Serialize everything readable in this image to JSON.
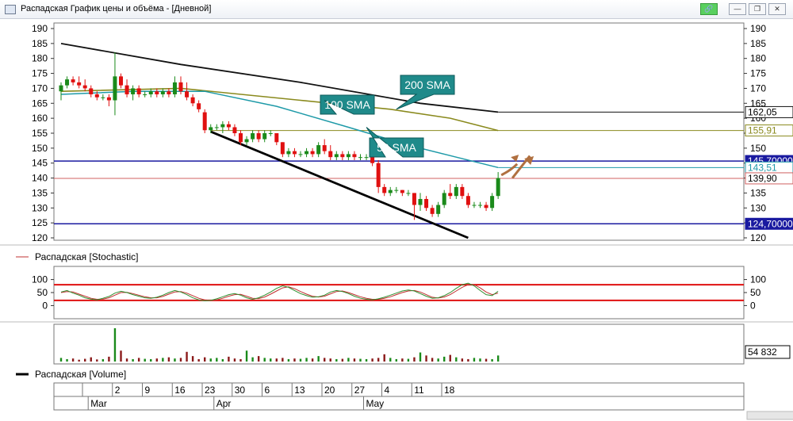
{
  "window": {
    "title": "Распадская График цены и объёма - [Дневной]",
    "buttons": {
      "link": "🔗",
      "min": "—",
      "max": "❐",
      "close": "✕"
    }
  },
  "colors": {
    "up": "#1a8a1a",
    "down": "#e01010",
    "sma50": "#1e9aa8",
    "sma100": "#8a8a1e",
    "sma200": "#111111",
    "hline_blue": "#1a1aa0",
    "hline_red": "#d06060",
    "callout_bg": "#1f8a8a",
    "arrow": "#b07040",
    "stoch_k": "#2f8f2f",
    "stoch_d": "#c03030",
    "stoch_level": "#e01010"
  },
  "chart_data": [
    {
      "type": "candlestick",
      "title": "",
      "ylim": [
        120,
        190
      ],
      "y_ticks": [
        120,
        125,
        130,
        135,
        140,
        145,
        150,
        155,
        160,
        165,
        170,
        175,
        180,
        185,
        190
      ],
      "candles": [
        {
          "o": 169,
          "h": 172,
          "l": 166,
          "c": 171
        },
        {
          "o": 171,
          "h": 174,
          "l": 170,
          "c": 173
        },
        {
          "o": 173,
          "h": 174,
          "l": 171,
          "c": 172
        },
        {
          "o": 172,
          "h": 174,
          "l": 170,
          "c": 171
        },
        {
          "o": 171,
          "h": 173,
          "l": 169,
          "c": 170
        },
        {
          "o": 170,
          "h": 171,
          "l": 167,
          "c": 168
        },
        {
          "o": 168,
          "h": 169,
          "l": 166,
          "c": 167
        },
        {
          "o": 167,
          "h": 168,
          "l": 166,
          "c": 167
        },
        {
          "o": 167,
          "h": 168,
          "l": 164,
          "c": 166
        },
        {
          "o": 166,
          "h": 182,
          "l": 161,
          "c": 174
        },
        {
          "o": 174,
          "h": 175,
          "l": 170,
          "c": 171
        },
        {
          "o": 171,
          "h": 173,
          "l": 167,
          "c": 168
        },
        {
          "o": 168,
          "h": 171,
          "l": 166,
          "c": 170
        },
        {
          "o": 170,
          "h": 171,
          "l": 167,
          "c": 168
        },
        {
          "o": 168,
          "h": 169,
          "l": 167,
          "c": 168
        },
        {
          "o": 168,
          "h": 170,
          "l": 167,
          "c": 169
        },
        {
          "o": 169,
          "h": 170,
          "l": 167,
          "c": 168
        },
        {
          "o": 168,
          "h": 170,
          "l": 167,
          "c": 169
        },
        {
          "o": 169,
          "h": 170,
          "l": 167,
          "c": 168
        },
        {
          "o": 168,
          "h": 174,
          "l": 167,
          "c": 172
        },
        {
          "o": 172,
          "h": 174,
          "l": 168,
          "c": 169
        },
        {
          "o": 169,
          "h": 172,
          "l": 166,
          "c": 167
        },
        {
          "o": 167,
          "h": 168,
          "l": 164,
          "c": 165
        },
        {
          "o": 165,
          "h": 166,
          "l": 162,
          "c": 163
        },
        {
          "o": 162,
          "h": 163,
          "l": 155,
          "c": 156
        },
        {
          "o": 156,
          "h": 158,
          "l": 155,
          "c": 157
        },
        {
          "o": 157,
          "h": 158,
          "l": 156,
          "c": 157
        },
        {
          "o": 157,
          "h": 159,
          "l": 155,
          "c": 158
        },
        {
          "o": 158,
          "h": 159,
          "l": 156,
          "c": 157
        },
        {
          "o": 157,
          "h": 158,
          "l": 154,
          "c": 155
        },
        {
          "o": 155,
          "h": 156,
          "l": 151,
          "c": 152
        },
        {
          "o": 152,
          "h": 154,
          "l": 151,
          "c": 153
        },
        {
          "o": 153,
          "h": 156,
          "l": 152,
          "c": 155
        },
        {
          "o": 155,
          "h": 156,
          "l": 152,
          "c": 153
        },
        {
          "o": 153,
          "h": 156,
          "l": 152,
          "c": 155
        },
        {
          "o": 155,
          "h": 156,
          "l": 154,
          "c": 155
        },
        {
          "o": 155,
          "h": 155,
          "l": 151,
          "c": 152
        },
        {
          "o": 152,
          "h": 152,
          "l": 147,
          "c": 148
        },
        {
          "o": 148,
          "h": 150,
          "l": 147,
          "c": 149
        },
        {
          "o": 149,
          "h": 150,
          "l": 147,
          "c": 148
        },
        {
          "o": 148,
          "h": 149,
          "l": 147,
          "c": 148
        },
        {
          "o": 148,
          "h": 150,
          "l": 147,
          "c": 149
        },
        {
          "o": 149,
          "h": 150,
          "l": 147,
          "c": 148
        },
        {
          "o": 148,
          "h": 152,
          "l": 147,
          "c": 151
        },
        {
          "o": 151,
          "h": 153,
          "l": 148,
          "c": 149
        },
        {
          "o": 149,
          "h": 151,
          "l": 146,
          "c": 147
        },
        {
          "o": 147,
          "h": 149,
          "l": 146,
          "c": 148
        },
        {
          "o": 148,
          "h": 149,
          "l": 146,
          "c": 147
        },
        {
          "o": 147,
          "h": 149,
          "l": 146,
          "c": 148
        },
        {
          "o": 148,
          "h": 149,
          "l": 146,
          "c": 147
        },
        {
          "o": 147,
          "h": 148,
          "l": 146,
          "c": 147
        },
        {
          "o": 147,
          "h": 148,
          "l": 146,
          "c": 147
        },
        {
          "o": 147,
          "h": 149,
          "l": 144,
          "c": 145
        },
        {
          "o": 145,
          "h": 146,
          "l": 135,
          "c": 137
        },
        {
          "o": 137,
          "h": 138,
          "l": 134,
          "c": 135
        },
        {
          "o": 135,
          "h": 137,
          "l": 134,
          "c": 136
        },
        {
          "o": 136,
          "h": 137,
          "l": 135,
          "c": 136
        },
        {
          "o": 136,
          "h": 136,
          "l": 134,
          "c": 135
        },
        {
          "o": 135,
          "h": 136,
          "l": 134,
          "c": 135
        },
        {
          "o": 135,
          "h": 135,
          "l": 126,
          "c": 131
        },
        {
          "o": 131,
          "h": 135,
          "l": 129,
          "c": 133
        },
        {
          "o": 133,
          "h": 134,
          "l": 129,
          "c": 130
        },
        {
          "o": 130,
          "h": 131,
          "l": 127,
          "c": 128
        },
        {
          "o": 128,
          "h": 132,
          "l": 127,
          "c": 131
        },
        {
          "o": 131,
          "h": 136,
          "l": 130,
          "c": 135
        },
        {
          "o": 135,
          "h": 138,
          "l": 133,
          "c": 134
        },
        {
          "o": 134,
          "h": 138,
          "l": 133,
          "c": 137
        },
        {
          "o": 137,
          "h": 138,
          "l": 133,
          "c": 134
        },
        {
          "o": 134,
          "h": 135,
          "l": 130,
          "c": 131
        },
        {
          "o": 131,
          "h": 132,
          "l": 130,
          "c": 131
        },
        {
          "o": 131,
          "h": 132,
          "l": 130,
          "c": 131
        },
        {
          "o": 131,
          "h": 132,
          "l": 129,
          "c": 130
        },
        {
          "o": 130,
          "h": 135,
          "l": 129,
          "c": 134
        },
        {
          "o": 134,
          "h": 142,
          "l": 133,
          "c": 140
        }
      ],
      "sma200": [
        {
          "i": 0,
          "v": 185
        },
        {
          "i": 20,
          "v": 178
        },
        {
          "i": 40,
          "v": 172
        },
        {
          "i": 60,
          "v": 165
        },
        {
          "i": 73,
          "v": 162.05
        }
      ],
      "sma100": [
        {
          "i": 0,
          "v": 169
        },
        {
          "i": 20,
          "v": 170
        },
        {
          "i": 40,
          "v": 166
        },
        {
          "i": 55,
          "v": 163
        },
        {
          "i": 65,
          "v": 160
        },
        {
          "i": 73,
          "v": 155.91
        }
      ],
      "sma50": [
        {
          "i": 0,
          "v": 168
        },
        {
          "i": 12,
          "v": 169
        },
        {
          "i": 24,
          "v": 169
        },
        {
          "i": 36,
          "v": 164
        },
        {
          "i": 48,
          "v": 157
        },
        {
          "i": 58,
          "v": 151
        },
        {
          "i": 66,
          "v": 147
        },
        {
          "i": 73,
          "v": 143.51
        }
      ],
      "trendline": [
        {
          "i": 25,
          "v": 155.5
        },
        {
          "i": 68,
          "v": 120
        }
      ],
      "hlines": [
        {
          "value": 162.05,
          "label": "162,05",
          "color": "#111111",
          "start_i": 73,
          "label_style": "plain"
        },
        {
          "value": 155.91,
          "label": "155,91",
          "color": "#8a8a1e",
          "start_i": 25,
          "label_style": "olive"
        },
        {
          "value": 145.7,
          "label": "145,70000",
          "color": "#1a1aa0",
          "start_i": 0,
          "label_style": "filled"
        },
        {
          "value": 143.51,
          "label": "143,51",
          "color": "#1e9aa8",
          "start_i": 73,
          "label_style": "teal"
        },
        {
          "value": 139.9,
          "label": "139,90",
          "color": "#d06060",
          "start_i": 0,
          "label_style": "plain"
        },
        {
          "value": 124.7,
          "label": "124,70000",
          "color": "#1a1aa0",
          "start_i": 0,
          "label_style": "filled"
        }
      ],
      "callouts": [
        {
          "label": "100 SMA",
          "target_i": 44,
          "target_v": 166
        },
        {
          "label": "200 SMA",
          "target_i": 56,
          "target_v": 163
        },
        {
          "label": "50 SMA",
          "target_i": 51,
          "target_v": 157
        }
      ]
    },
    {
      "type": "line",
      "title": "Распадская [Stochastic]",
      "ylim": [
        -20,
        120
      ],
      "y_ticks": [
        0,
        50,
        100
      ],
      "levels": [
        80,
        20
      ],
      "k": [
        52,
        58,
        48,
        40,
        30,
        25,
        22,
        28,
        35,
        48,
        55,
        50,
        42,
        36,
        30,
        28,
        32,
        40,
        50,
        58,
        52,
        42,
        30,
        22,
        18,
        20,
        26,
        34,
        42,
        46,
        40,
        30,
        24,
        30,
        40,
        52,
        66,
        76,
        70,
        58,
        46,
        38,
        32,
        34,
        40,
        52,
        58,
        54,
        46,
        36,
        28,
        24,
        22,
        26,
        32,
        40,
        48,
        56,
        60,
        56,
        46,
        36,
        28,
        30,
        38,
        50,
        66,
        80,
        86,
        76,
        58,
        42,
        38,
        55
      ],
      "d": [
        50,
        54,
        52,
        44,
        36,
        28,
        24,
        25,
        30,
        40,
        50,
        51,
        46,
        40,
        34,
        30,
        30,
        35,
        44,
        52,
        54,
        48,
        38,
        28,
        22,
        20,
        22,
        28,
        36,
        42,
        43,
        36,
        28,
        27,
        33,
        44,
        56,
        68,
        72,
        65,
        54,
        44,
        36,
        33,
        36,
        45,
        54,
        56,
        50,
        42,
        34,
        28,
        24,
        24,
        28,
        34,
        42,
        50,
        56,
        58,
        52,
        42,
        32,
        29,
        33,
        42,
        56,
        70,
        80,
        80,
        68,
        52,
        42,
        48
      ],
      "series": [
        {
          "name": "Распадская [Stochastic]"
        }
      ]
    },
    {
      "type": "bar",
      "title": "Распадская [Volume]",
      "last_value_label": "54 832",
      "volumes": [
        12,
        8,
        10,
        6,
        9,
        14,
        7,
        8,
        16,
        110,
        36,
        10,
        8,
        12,
        9,
        8,
        10,
        12,
        14,
        10,
        12,
        32,
        18,
        8,
        14,
        10,
        12,
        8,
        16,
        10,
        8,
        36,
        14,
        18,
        12,
        10,
        10,
        12,
        8,
        10,
        9,
        12,
        10,
        18,
        12,
        10,
        8,
        9,
        12,
        10,
        9,
        8,
        10,
        12,
        24,
        12,
        8,
        10,
        9,
        14,
        30,
        20,
        12,
        10,
        16,
        22,
        14,
        10,
        8,
        12,
        10,
        9,
        8,
        20
      ]
    }
  ],
  "x_axis": {
    "day_labels": [
      {
        "i": 0,
        "label": ""
      },
      {
        "i": 5,
        "label": "2"
      },
      {
        "i": 10,
        "label": "9"
      },
      {
        "i": 15,
        "label": "16"
      },
      {
        "i": 20,
        "label": "23"
      },
      {
        "i": 25,
        "label": "30"
      },
      {
        "i": 30,
        "label": "6"
      },
      {
        "i": 35,
        "label": "13"
      },
      {
        "i": 40,
        "label": "20"
      },
      {
        "i": 45,
        "label": "27"
      },
      {
        "i": 50,
        "label": "4"
      },
      {
        "i": 55,
        "label": "11"
      },
      {
        "i": 60,
        "label": "18"
      }
    ],
    "month_labels": [
      {
        "i": 4,
        "label": "Mar"
      },
      {
        "i": 25,
        "label": "Apr"
      },
      {
        "i": 50,
        "label": "May"
      }
    ]
  }
}
